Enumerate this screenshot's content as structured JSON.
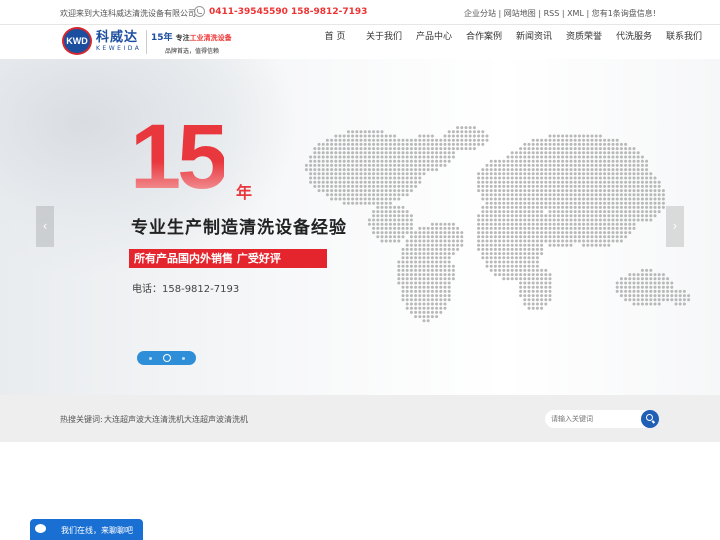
{
  "topbar": {
    "welcome": "欢迎来到大连科威达清洗设备有限公司",
    "phone": "0411-39545590  158-9812-7193",
    "links": "企业分站 | 网站地图 | RSS | XML | 您有1条询盘信息!"
  },
  "logo": {
    "badge": "KWD",
    "cn": "科威达",
    "en": "KEWEIDA"
  },
  "slogan": {
    "years": "15年",
    "prefix": "专注",
    "highlight": "工业清洗设备",
    "sub": "品牌首选，值得信赖"
  },
  "nav": [
    "首 页",
    "关于我们",
    "产品中心",
    "合作案例",
    "新闻资讯",
    "资质荣誉",
    "代洗服务",
    "联系我们"
  ],
  "banner": {
    "number": "15",
    "unit": "年",
    "headline": "专业生产制造清洗设备经验",
    "redbar": "所有产品国内外销售   广受好评",
    "tel": "电话：158-9812-7193",
    "slides": 3,
    "active_slide": 2
  },
  "keywords": {
    "label": "热搜关键词:",
    "items": [
      "大连超声波",
      "大连清洗机",
      "大连超声波清洗机"
    ]
  },
  "search": {
    "placeholder": "请输入关键词"
  },
  "chat": {
    "text": "我们在线，来聊聊吧"
  },
  "colors": {
    "brand_blue": "#1c4ea0",
    "accent_red": "#e5252d",
    "chat_blue": "#1a6fd3",
    "map_gray": "#b8b8b8"
  },
  "icons": [
    "phone-icon",
    "arrow-left-icon",
    "arrow-right-icon",
    "search-icon",
    "chat-bubble-icon"
  ]
}
